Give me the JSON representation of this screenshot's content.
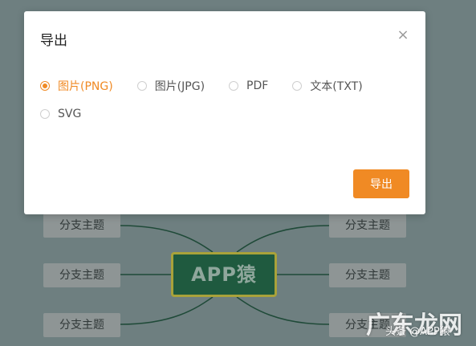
{
  "dialog": {
    "title": "导出",
    "close_icon": "×",
    "options": [
      {
        "label": "图片(PNG)",
        "checked": true
      },
      {
        "label": "图片(JPG)",
        "checked": false
      },
      {
        "label": "PDF",
        "checked": false
      },
      {
        "label": "文本(TXT)",
        "checked": false
      },
      {
        "label": "SVG",
        "checked": false
      }
    ],
    "export_label": "导出",
    "accent": "#f08a24"
  },
  "mindmap": {
    "central_topic": "APP猿",
    "branches": [
      "分支主题",
      "分支主题",
      "分支主题",
      "分支主题",
      "分支主题",
      "分支主题"
    ]
  },
  "watermark": {
    "site": "广东龙网",
    "account": "头条 @APP猿"
  }
}
